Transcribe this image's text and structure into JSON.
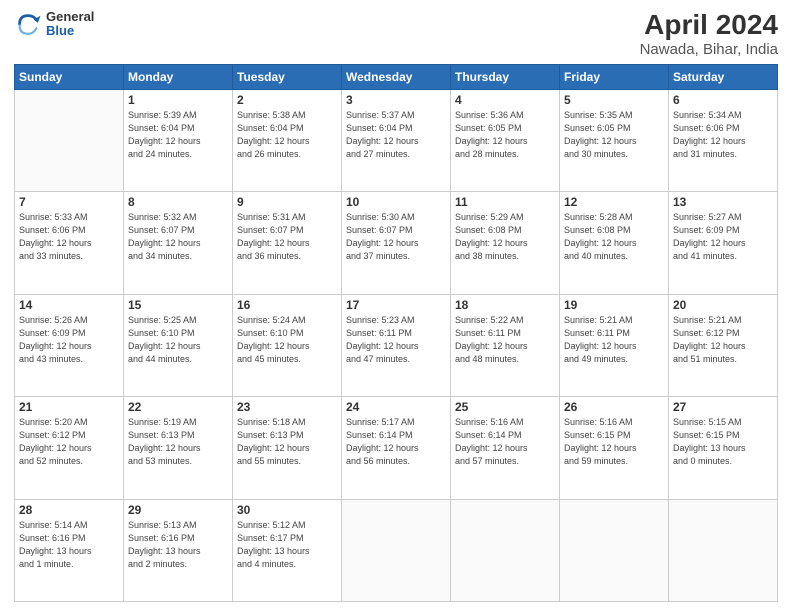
{
  "logo": {
    "general": "General",
    "blue": "Blue"
  },
  "title": "April 2024",
  "subtitle": "Nawada, Bihar, India",
  "weekdays": [
    "Sunday",
    "Monday",
    "Tuesday",
    "Wednesday",
    "Thursday",
    "Friday",
    "Saturday"
  ],
  "weeks": [
    [
      {
        "day": "",
        "info": ""
      },
      {
        "day": "1",
        "info": "Sunrise: 5:39 AM\nSunset: 6:04 PM\nDaylight: 12 hours\nand 24 minutes."
      },
      {
        "day": "2",
        "info": "Sunrise: 5:38 AM\nSunset: 6:04 PM\nDaylight: 12 hours\nand 26 minutes."
      },
      {
        "day": "3",
        "info": "Sunrise: 5:37 AM\nSunset: 6:04 PM\nDaylight: 12 hours\nand 27 minutes."
      },
      {
        "day": "4",
        "info": "Sunrise: 5:36 AM\nSunset: 6:05 PM\nDaylight: 12 hours\nand 28 minutes."
      },
      {
        "day": "5",
        "info": "Sunrise: 5:35 AM\nSunset: 6:05 PM\nDaylight: 12 hours\nand 30 minutes."
      },
      {
        "day": "6",
        "info": "Sunrise: 5:34 AM\nSunset: 6:06 PM\nDaylight: 12 hours\nand 31 minutes."
      }
    ],
    [
      {
        "day": "7",
        "info": "Sunrise: 5:33 AM\nSunset: 6:06 PM\nDaylight: 12 hours\nand 33 minutes."
      },
      {
        "day": "8",
        "info": "Sunrise: 5:32 AM\nSunset: 6:07 PM\nDaylight: 12 hours\nand 34 minutes."
      },
      {
        "day": "9",
        "info": "Sunrise: 5:31 AM\nSunset: 6:07 PM\nDaylight: 12 hours\nand 36 minutes."
      },
      {
        "day": "10",
        "info": "Sunrise: 5:30 AM\nSunset: 6:07 PM\nDaylight: 12 hours\nand 37 minutes."
      },
      {
        "day": "11",
        "info": "Sunrise: 5:29 AM\nSunset: 6:08 PM\nDaylight: 12 hours\nand 38 minutes."
      },
      {
        "day": "12",
        "info": "Sunrise: 5:28 AM\nSunset: 6:08 PM\nDaylight: 12 hours\nand 40 minutes."
      },
      {
        "day": "13",
        "info": "Sunrise: 5:27 AM\nSunset: 6:09 PM\nDaylight: 12 hours\nand 41 minutes."
      }
    ],
    [
      {
        "day": "14",
        "info": "Sunrise: 5:26 AM\nSunset: 6:09 PM\nDaylight: 12 hours\nand 43 minutes."
      },
      {
        "day": "15",
        "info": "Sunrise: 5:25 AM\nSunset: 6:10 PM\nDaylight: 12 hours\nand 44 minutes."
      },
      {
        "day": "16",
        "info": "Sunrise: 5:24 AM\nSunset: 6:10 PM\nDaylight: 12 hours\nand 45 minutes."
      },
      {
        "day": "17",
        "info": "Sunrise: 5:23 AM\nSunset: 6:11 PM\nDaylight: 12 hours\nand 47 minutes."
      },
      {
        "day": "18",
        "info": "Sunrise: 5:22 AM\nSunset: 6:11 PM\nDaylight: 12 hours\nand 48 minutes."
      },
      {
        "day": "19",
        "info": "Sunrise: 5:21 AM\nSunset: 6:11 PM\nDaylight: 12 hours\nand 49 minutes."
      },
      {
        "day": "20",
        "info": "Sunrise: 5:21 AM\nSunset: 6:12 PM\nDaylight: 12 hours\nand 51 minutes."
      }
    ],
    [
      {
        "day": "21",
        "info": "Sunrise: 5:20 AM\nSunset: 6:12 PM\nDaylight: 12 hours\nand 52 minutes."
      },
      {
        "day": "22",
        "info": "Sunrise: 5:19 AM\nSunset: 6:13 PM\nDaylight: 12 hours\nand 53 minutes."
      },
      {
        "day": "23",
        "info": "Sunrise: 5:18 AM\nSunset: 6:13 PM\nDaylight: 12 hours\nand 55 minutes."
      },
      {
        "day": "24",
        "info": "Sunrise: 5:17 AM\nSunset: 6:14 PM\nDaylight: 12 hours\nand 56 minutes."
      },
      {
        "day": "25",
        "info": "Sunrise: 5:16 AM\nSunset: 6:14 PM\nDaylight: 12 hours\nand 57 minutes."
      },
      {
        "day": "26",
        "info": "Sunrise: 5:16 AM\nSunset: 6:15 PM\nDaylight: 12 hours\nand 59 minutes."
      },
      {
        "day": "27",
        "info": "Sunrise: 5:15 AM\nSunset: 6:15 PM\nDaylight: 13 hours\nand 0 minutes."
      }
    ],
    [
      {
        "day": "28",
        "info": "Sunrise: 5:14 AM\nSunset: 6:16 PM\nDaylight: 13 hours\nand 1 minute."
      },
      {
        "day": "29",
        "info": "Sunrise: 5:13 AM\nSunset: 6:16 PM\nDaylight: 13 hours\nand 2 minutes."
      },
      {
        "day": "30",
        "info": "Sunrise: 5:12 AM\nSunset: 6:17 PM\nDaylight: 13 hours\nand 4 minutes."
      },
      {
        "day": "",
        "info": ""
      },
      {
        "day": "",
        "info": ""
      },
      {
        "day": "",
        "info": ""
      },
      {
        "day": "",
        "info": ""
      }
    ]
  ]
}
